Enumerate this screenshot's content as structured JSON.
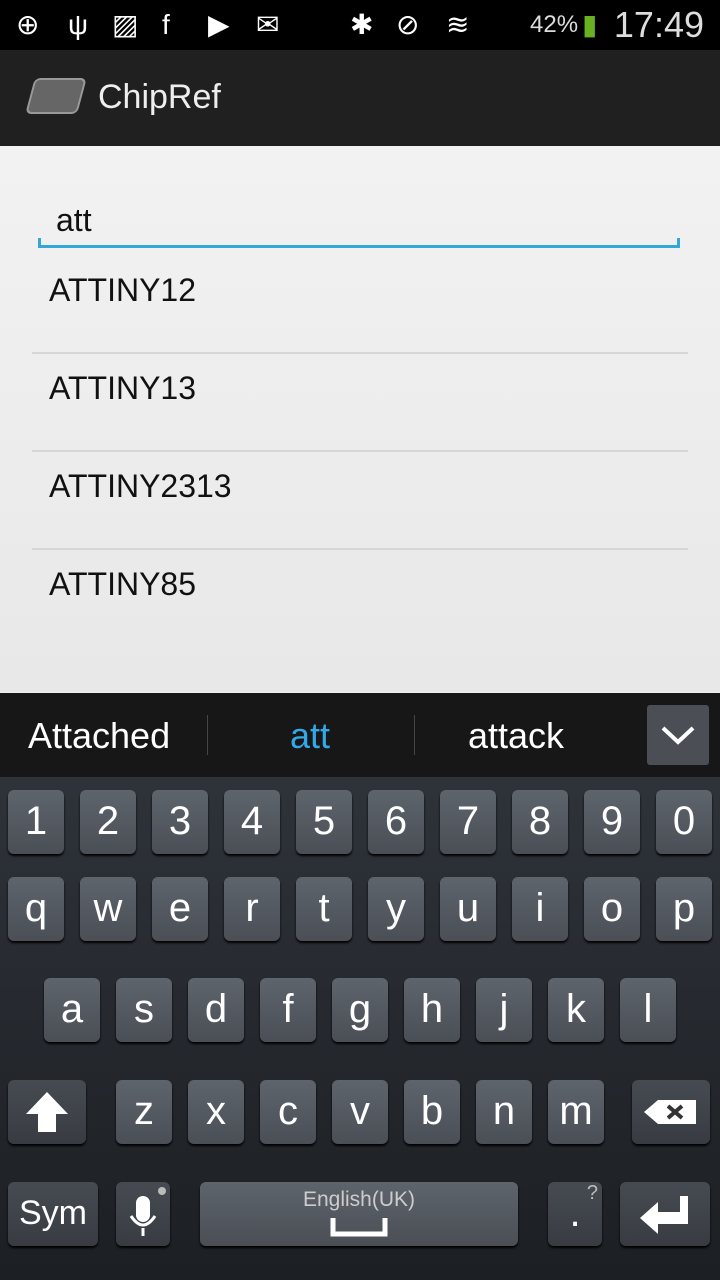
{
  "status_bar": {
    "icons_left": [
      "add-icon",
      "usb-icon",
      "image-icon",
      "facebook-icon",
      "play-store-icon",
      "email-icon"
    ],
    "icons_right": [
      "bluetooth-icon",
      "vibrate-icon",
      "wifi-icon",
      "signal-icon"
    ],
    "battery": "42%",
    "time": "17:49",
    "accent_battery": "#6ab023"
  },
  "action_bar": {
    "title": "ChipRef"
  },
  "search": {
    "value": "att"
  },
  "results": [
    "ATTINY12",
    "ATTINY13",
    "ATTINY2313",
    "ATTINY85"
  ],
  "suggestions": {
    "items": [
      "Attached",
      "att",
      "attack"
    ],
    "highlight_color": "#33a8e8"
  },
  "keyboard": {
    "row1": [
      "1",
      "2",
      "3",
      "4",
      "5",
      "6",
      "7",
      "8",
      "9",
      "0"
    ],
    "row2": [
      "q",
      "w",
      "e",
      "r",
      "t",
      "y",
      "u",
      "i",
      "o",
      "p"
    ],
    "row3": [
      "a",
      "s",
      "d",
      "f",
      "g",
      "h",
      "j",
      "k",
      "l"
    ],
    "row4": [
      "z",
      "x",
      "c",
      "v",
      "b",
      "n",
      "m"
    ],
    "sym": "Sym",
    "space_language": "English(UK)",
    "period": ".",
    "period_hint": "?"
  },
  "accent": "#33a8d8"
}
